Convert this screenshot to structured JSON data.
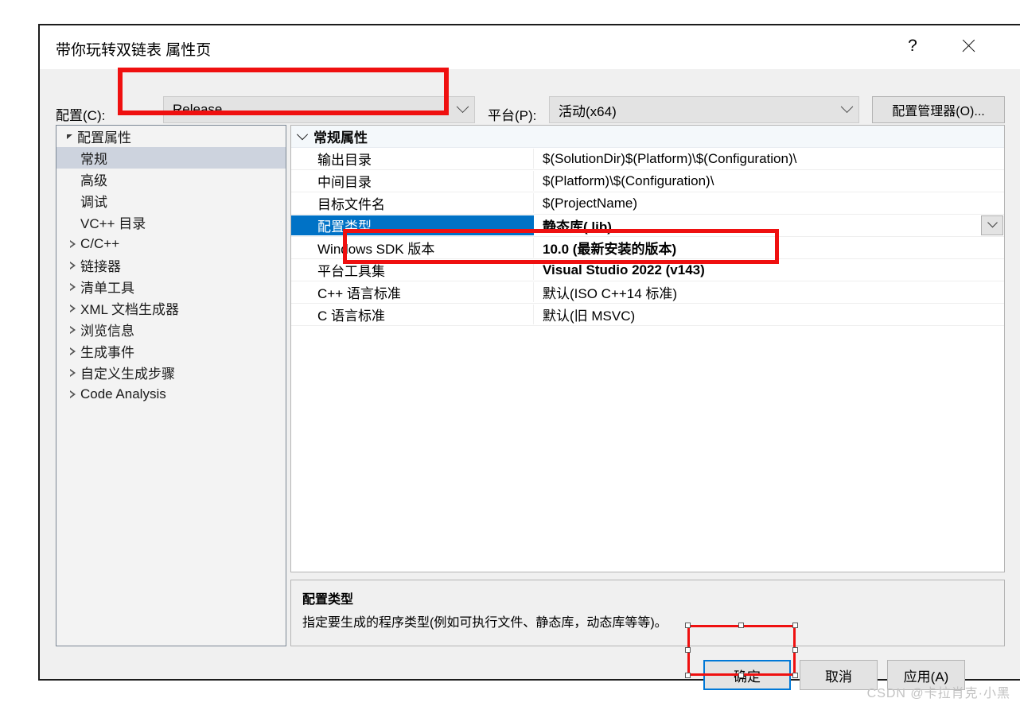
{
  "dialog": {
    "title": "带你玩转双链表 属性页",
    "help_label": "?",
    "close_label": "关闭"
  },
  "configbar": {
    "config_label": "配置(C):",
    "config_value": "Release",
    "platform_label": "平台(P):",
    "platform_value": "活动(x64)",
    "config_manager_label": "配置管理器(O)..."
  },
  "tree": {
    "items": [
      {
        "label": "配置属性",
        "indent": 0,
        "arrow": "expanded",
        "selected": false
      },
      {
        "label": "常规",
        "indent": 1,
        "arrow": "none",
        "selected": true
      },
      {
        "label": "高级",
        "indent": 1,
        "arrow": "none",
        "selected": false
      },
      {
        "label": "调试",
        "indent": 1,
        "arrow": "none",
        "selected": false
      },
      {
        "label": "VC++ 目录",
        "indent": 1,
        "arrow": "none",
        "selected": false
      },
      {
        "label": "C/C++",
        "indent": 1,
        "arrow": "collapsed",
        "selected": false
      },
      {
        "label": "链接器",
        "indent": 1,
        "arrow": "collapsed",
        "selected": false
      },
      {
        "label": "清单工具",
        "indent": 1,
        "arrow": "collapsed",
        "selected": false
      },
      {
        "label": "XML 文档生成器",
        "indent": 1,
        "arrow": "collapsed",
        "selected": false
      },
      {
        "label": "浏览信息",
        "indent": 1,
        "arrow": "collapsed",
        "selected": false
      },
      {
        "label": "生成事件",
        "indent": 1,
        "arrow": "collapsed",
        "selected": false
      },
      {
        "label": "自定义生成步骤",
        "indent": 1,
        "arrow": "collapsed",
        "selected": false
      },
      {
        "label": "Code Analysis",
        "indent": 1,
        "arrow": "collapsed",
        "selected": false
      }
    ]
  },
  "grid": {
    "section_header": "常规属性",
    "rows": [
      {
        "name": "输出目录",
        "value": "$(SolutionDir)$(Platform)\\$(Configuration)\\",
        "bold": false,
        "selected": false,
        "dropdown": false
      },
      {
        "name": "中间目录",
        "value": "$(Platform)\\$(Configuration)\\",
        "bold": false,
        "selected": false,
        "dropdown": false
      },
      {
        "name": "目标文件名",
        "value": "$(ProjectName)",
        "bold": false,
        "selected": false,
        "dropdown": false
      },
      {
        "name": "配置类型",
        "value": "静态库(.lib)",
        "bold": true,
        "selected": true,
        "dropdown": true
      },
      {
        "name": "Windows SDK 版本",
        "value": "10.0 (最新安装的版本)",
        "bold": true,
        "selected": false,
        "dropdown": false
      },
      {
        "name": "平台工具集",
        "value": "Visual Studio 2022 (v143)",
        "bold": true,
        "selected": false,
        "dropdown": false
      },
      {
        "name": "C++ 语言标准",
        "value": "默认(ISO C++14 标准)",
        "bold": false,
        "selected": false,
        "dropdown": false
      },
      {
        "name": "C 语言标准",
        "value": "默认(旧 MSVC)",
        "bold": false,
        "selected": false,
        "dropdown": false
      }
    ]
  },
  "description": {
    "title": "配置类型",
    "body": "指定要生成的程序类型(例如可执行文件、静态库，动态库等等)。"
  },
  "footer": {
    "ok_label": "确定",
    "cancel_label": "取消",
    "apply_label": "应用(A)"
  },
  "watermark": {
    "text": "CSDN @卡拉肖克·小黑"
  },
  "colors": {
    "annotation_red": "#ef1010",
    "selection_blue": "#0072c6",
    "focus_blue": "#0078d7",
    "tree_selection": "#cdd3de"
  }
}
